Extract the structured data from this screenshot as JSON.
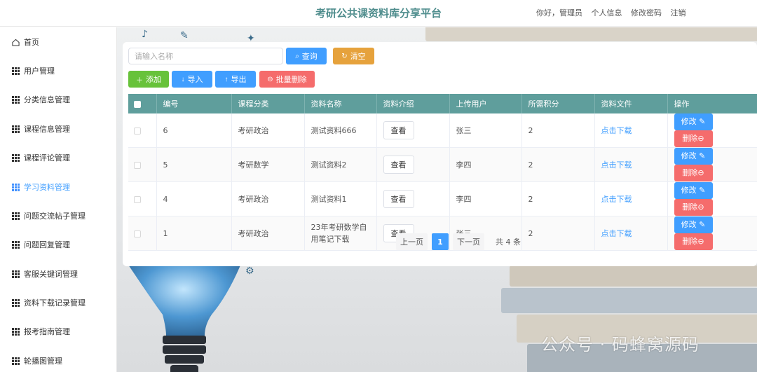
{
  "header": {
    "title": "考研公共课资料库分享平台",
    "greeting": "你好，管理员",
    "profile_link": "个人信息",
    "change_password_link": "修改密码",
    "logout_link": "注销"
  },
  "sidebar": {
    "items": [
      {
        "label": "首页",
        "icon": "home-icon"
      },
      {
        "label": "用户管理",
        "icon": "grid-icon"
      },
      {
        "label": "分类信息管理",
        "icon": "grid-icon"
      },
      {
        "label": "课程信息管理",
        "icon": "grid-icon"
      },
      {
        "label": "课程评论管理",
        "icon": "grid-icon"
      },
      {
        "label": "学习资料管理",
        "icon": "grid-icon",
        "active": true
      },
      {
        "label": "问题交流帖子管理",
        "icon": "grid-icon"
      },
      {
        "label": "问题回复管理",
        "icon": "grid-icon"
      },
      {
        "label": "客服关键词管理",
        "icon": "grid-icon"
      },
      {
        "label": "资料下载记录管理",
        "icon": "grid-icon"
      },
      {
        "label": "报考指南管理",
        "icon": "grid-icon"
      },
      {
        "label": "轮播图管理",
        "icon": "grid-icon"
      }
    ],
    "active_color": "#409eff"
  },
  "search": {
    "placeholder": "请输入名称",
    "value": "",
    "query_label": "查询",
    "reset_label": "清空"
  },
  "toolbar": {
    "add_label": "添加",
    "import_label": "导入",
    "export_label": "导出",
    "batch_delete_label": "批量删除"
  },
  "colors": {
    "primary": "#409eff",
    "success": "#67c23a",
    "warning": "#e6a23c",
    "danger": "#f56c6c",
    "table_header": "#5f9e9c",
    "title": "#4f8d8d"
  },
  "table": {
    "headers": [
      "编号",
      "课程分类",
      "资料名称",
      "资料介绍",
      "上传用户",
      "所需积分",
      "资料文件",
      "操作"
    ],
    "view_label": "查看",
    "download_label": "点击下载",
    "edit_label": "修改",
    "delete_label": "删除",
    "rows": [
      {
        "id": "6",
        "category": "考研政治",
        "name": "测试资料666",
        "user": "张三",
        "points": "2"
      },
      {
        "id": "5",
        "category": "考研数学",
        "name": "测试资料2",
        "user": "李四",
        "points": "2"
      },
      {
        "id": "4",
        "category": "考研政治",
        "name": "测试资料1",
        "user": "李四",
        "points": "2"
      },
      {
        "id": "1",
        "category": "考研政治",
        "name": "23年考研数学自用笔记下载",
        "user": "张三",
        "points": "2"
      }
    ]
  },
  "pagination": {
    "prev_label": "上一页",
    "current_page": "1",
    "next_label": "下一页",
    "total_label": "共 4 条"
  },
  "watermark": "公众号 · 码蜂窝源码"
}
